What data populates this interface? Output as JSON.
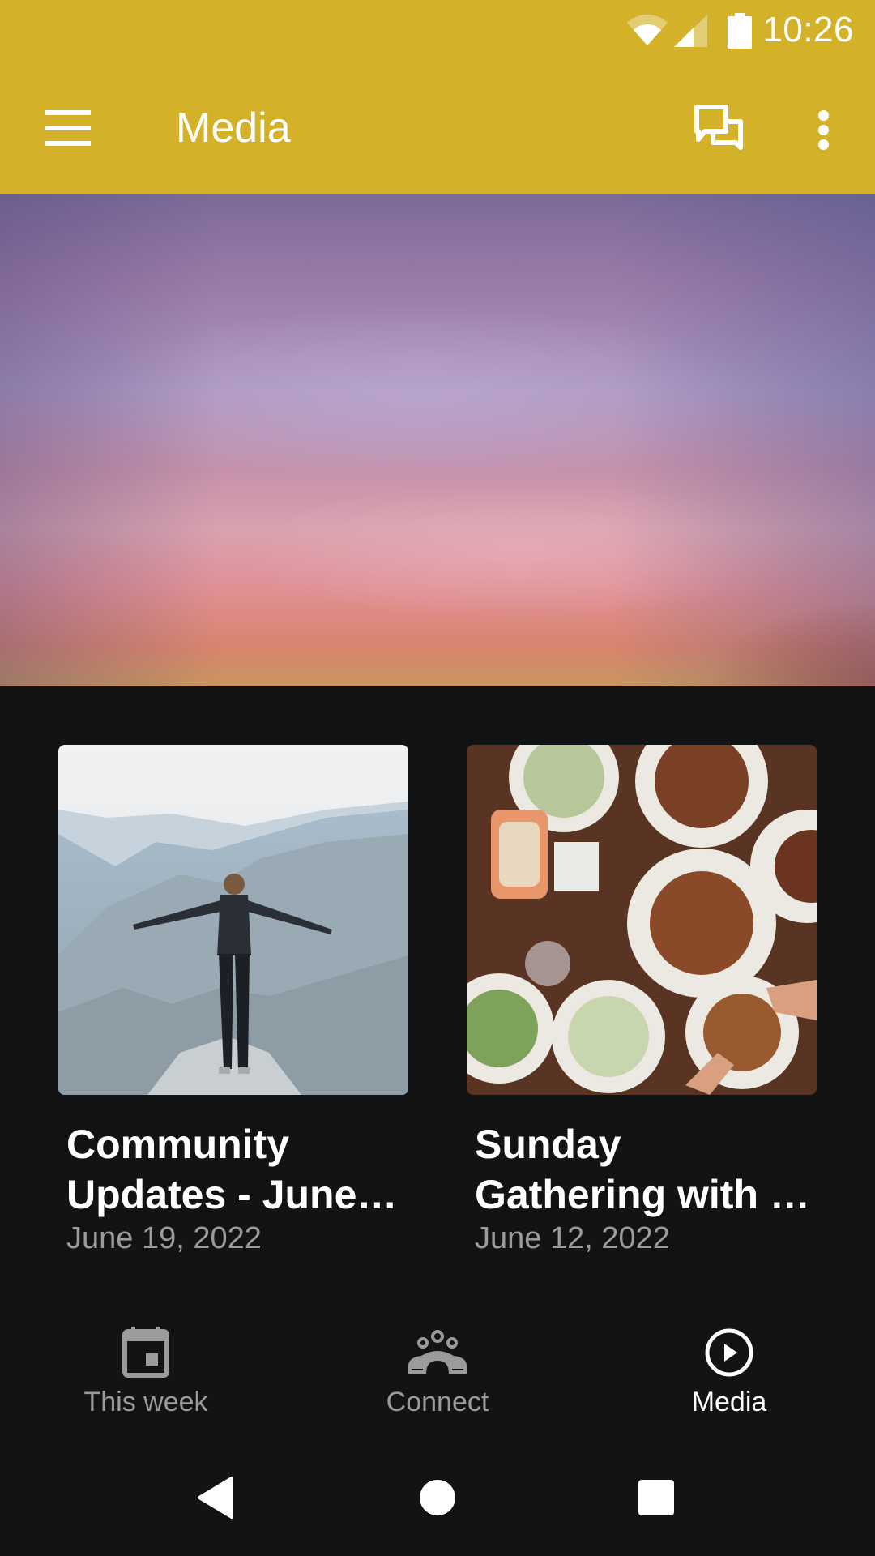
{
  "status_bar": {
    "time": "10:26",
    "icons": [
      "wifi-icon",
      "cell-signal-icon",
      "battery-icon"
    ]
  },
  "app_bar": {
    "title": "Media",
    "menu_icon": "hamburger-menu-icon",
    "actions": [
      {
        "name": "chat",
        "icon": "chat-bubbles-icon"
      },
      {
        "name": "more",
        "icon": "more-vertical-icon"
      }
    ],
    "color": "#D3B22A"
  },
  "hero": {
    "image": "sunset-sky-banner"
  },
  "media_items": [
    {
      "title": "Community Updates - June…",
      "date": "June 19, 2022",
      "thumbnail": "person-on-mountain-cliff"
    },
    {
      "title": "Sunday Gathering with …",
      "date": "June 12, 2022",
      "thumbnail": "table-with-food-plates"
    }
  ],
  "bottom_nav": {
    "items": [
      {
        "label": "This week",
        "icon": "calendar-icon",
        "active": false
      },
      {
        "label": "Connect",
        "icon": "group-icon",
        "active": false
      },
      {
        "label": "Media",
        "icon": "play-circle-icon",
        "active": true
      }
    ]
  },
  "system_nav": {
    "buttons": [
      "back",
      "home",
      "recents"
    ]
  },
  "colors": {
    "background": "#121315",
    "inactive_text": "#9A9B9D",
    "active_text": "#FFFFFF"
  }
}
